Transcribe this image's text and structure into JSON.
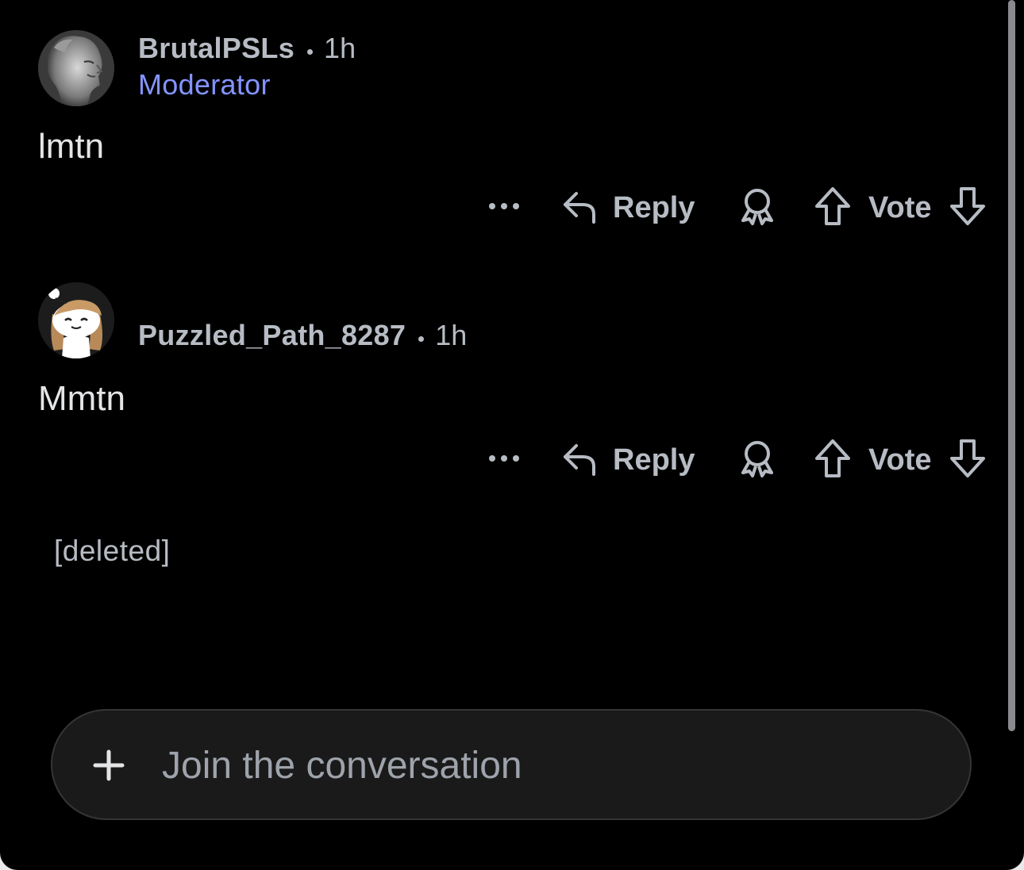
{
  "colors": {
    "background": "#000000",
    "meta_text": "#b7bcc4",
    "flair": "#8494ff",
    "body_text": "#e4e5e7",
    "composer_bg": "#1a1a1b"
  },
  "comments": [
    {
      "username": "BrutalPSLs",
      "time": "1h",
      "flair": "Moderator",
      "avatar_icon": "statue-avatar-icon",
      "body": "lmtn",
      "actions": {
        "more_icon": "ellipsis-icon",
        "reply_label": "Reply",
        "award_icon": "award-icon",
        "upvote_icon": "upvote-arrow-icon",
        "vote_label": "Vote",
        "downvote_icon": "downvote-arrow-icon"
      }
    },
    {
      "username": "Puzzled_Path_8287",
      "time": "1h",
      "avatar_icon": "snoo-avatar-icon",
      "body": "Mmtn",
      "actions": {
        "more_icon": "ellipsis-icon",
        "reply_label": "Reply",
        "award_icon": "award-icon",
        "upvote_icon": "upvote-arrow-icon",
        "vote_label": "Vote",
        "downvote_icon": "downvote-arrow-icon"
      }
    }
  ],
  "deleted_comment": "[deleted]",
  "composer": {
    "plus_icon": "plus-icon",
    "placeholder": "Join the conversation"
  }
}
